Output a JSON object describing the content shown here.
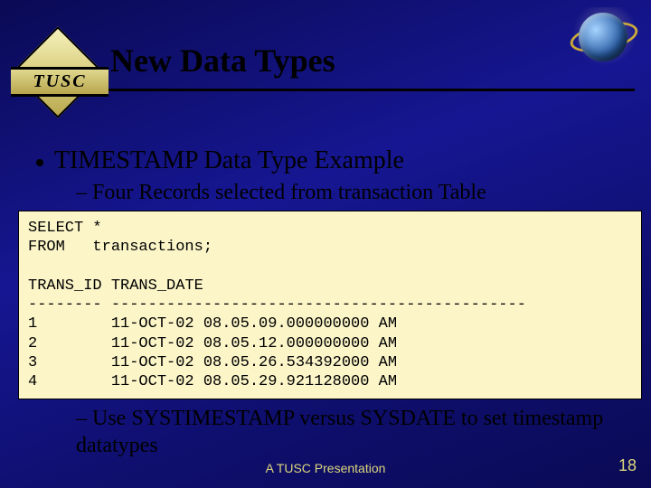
{
  "logo": {
    "brand_text": "TUSC"
  },
  "title": "New Data Types",
  "bullets": {
    "l1": "TIMESTAMP Data Type Example",
    "l2a": "– Four Records selected from transaction Table",
    "l2b": "– Use SYSTIMESTAMP versus SYSDATE to set timestamp datatypes"
  },
  "code": "SELECT *\nFROM   transactions;\n\nTRANS_ID TRANS_DATE\n-------- ---------------------------------------------\n1        11-OCT-02 08.05.09.000000000 AM\n2        11-OCT-02 08.05.12.000000000 AM\n3        11-OCT-02 08.05.26.534392000 AM\n4        11-OCT-02 08.05.29.921128000 AM",
  "footer": {
    "note": "A TUSC Presentation",
    "page": "18"
  },
  "chart_data": {
    "type": "table",
    "title": "SELECT * FROM transactions;",
    "columns": [
      "TRANS_ID",
      "TRANS_DATE"
    ],
    "rows": [
      [
        1,
        "11-OCT-02 08.05.09.000000000 AM"
      ],
      [
        2,
        "11-OCT-02 08.05.12.000000000 AM"
      ],
      [
        3,
        "11-OCT-02 08.05.26.534392000 AM"
      ],
      [
        4,
        "11-OCT-02 08.05.29.921128000 AM"
      ]
    ]
  }
}
